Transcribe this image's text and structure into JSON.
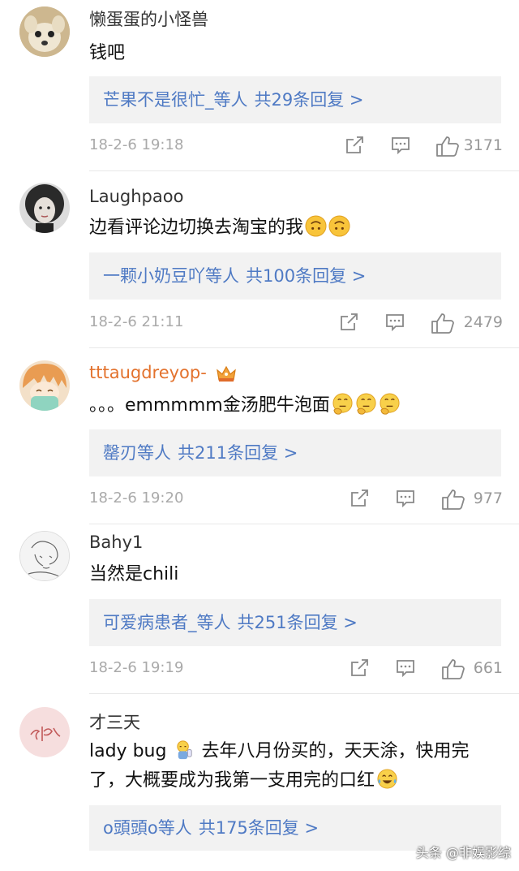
{
  "comments": [
    {
      "username": "懒蛋蛋的小怪兽",
      "text": "钱吧",
      "replies_users": "芒果不是很忙_等人",
      "replies_count": "共29条回复 >",
      "time": "18-2-6 19:18",
      "likes": "3171"
    },
    {
      "username": "Laughpaoo",
      "text": "边看评论边切换去淘宝的我",
      "replies_users": "一颗小奶豆吖等人",
      "replies_count": "共100条回复 >",
      "time": "18-2-6 21:11",
      "likes": "2479"
    },
    {
      "username": "tttaugdreyop-",
      "text": "。。。emmmmm金汤肥牛泡面",
      "replies_users": "罄刃等人",
      "replies_count": "共211条回复 >",
      "time": "18-2-6 19:20",
      "likes": "977"
    },
    {
      "username": "Bahy1",
      "text": "当然是chili",
      "replies_users": "可爱病患者_等人",
      "replies_count": "共251条回复 >",
      "time": "18-2-6 19:19",
      "likes": "661"
    },
    {
      "username": "才三天",
      "text_part1": "lady bug",
      "text_part2": "去年八月份买的，天天涂，快用完了，大概要成为我第一支用完的口红",
      "replies_users": "o頭頭o等人",
      "replies_count": "共175条回复 >"
    }
  ],
  "watermark": "头条 @非娱影综",
  "colors": {
    "link": "#4f7ac4",
    "vip_name": "#e3722d",
    "meta": "#aaaaaa",
    "reply_bg": "#f2f2f2"
  }
}
